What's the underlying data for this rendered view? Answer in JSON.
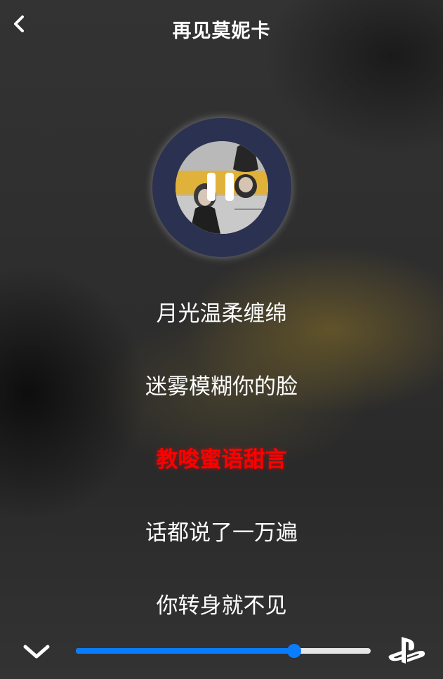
{
  "header": {
    "title": "再见莫妮卡",
    "back_icon": "chevron-left-icon"
  },
  "player": {
    "cover_icon": "album-cover-image",
    "state_icon": "pause-icon",
    "disc_color": "#2b3150"
  },
  "lyrics": {
    "lines": [
      "月光温柔缠绵",
      "迷雾模糊你的脸",
      "教唆蜜语甜言",
      "话都说了一万遍",
      "你转身就不见"
    ],
    "active_index": 2,
    "active_color": "#ff0000"
  },
  "footer": {
    "collapse_icon": "chevron-down-icon",
    "progress": 0.74,
    "progress_color": "#0a7cff",
    "brand_icon": "playstation-icon"
  }
}
